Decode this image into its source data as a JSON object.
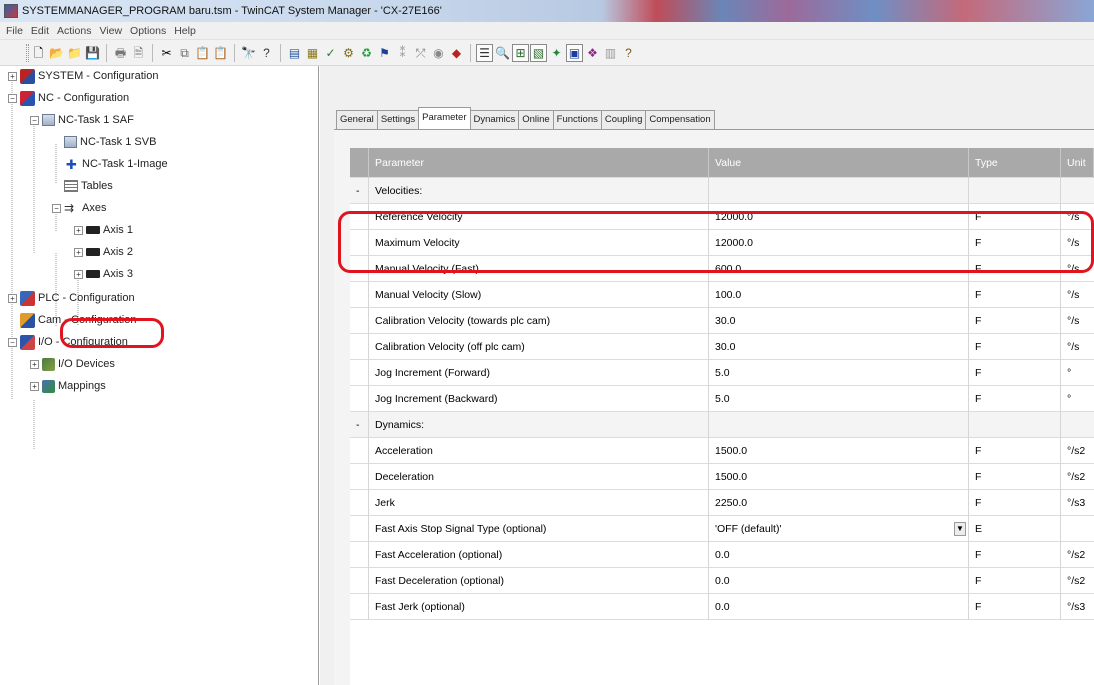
{
  "window": {
    "title": "SYSTEMMANAGER_PROGRAM baru.tsm - TwinCAT System Manager - 'CX-27E166'"
  },
  "menu": [
    "File",
    "Edit",
    "Actions",
    "View",
    "Options",
    "Help"
  ],
  "toolbar": {
    "icons": [
      "new-icon",
      "open-icon",
      "open-remote-icon",
      "save-icon",
      "print-icon",
      "print-preview-icon",
      "cut-icon",
      "copy-icon",
      "paste-icon",
      "paste-with-links-icon",
      "find-icon",
      "help-icon",
      "generate-mappings-icon",
      "check-configuration-icon",
      "activate-configuration-icon",
      "set-run-mode-icon",
      "restart-config-icon",
      "reload-devices-icon",
      "scan-devices-icon",
      "toggle-freerun-icon",
      "show-online-data-icon",
      "show-sub-items-icon",
      "zoom-icon",
      "view-icon",
      "graph-icon",
      "record-icon",
      "watch-icon",
      "settings-icon",
      "info-icon"
    ]
  },
  "tree": {
    "items": [
      {
        "label": "SYSTEM - Configuration"
      },
      {
        "label": "NC - Configuration"
      },
      {
        "label": "NC-Task 1 SAF"
      },
      {
        "label": "NC-Task 1 SVB"
      },
      {
        "label": "NC-Task 1-Image"
      },
      {
        "label": "Tables"
      },
      {
        "label": "Axes"
      },
      {
        "label": "Axis 1"
      },
      {
        "label": "Axis 2"
      },
      {
        "label": "Axis 3"
      },
      {
        "label": "PLC - Configuration"
      },
      {
        "label": "Cam - Configuration"
      },
      {
        "label": "I/O - Configuration"
      },
      {
        "label": "I/O Devices"
      },
      {
        "label": "Mappings"
      }
    ]
  },
  "tabs": [
    "General",
    "Settings",
    "Parameter",
    "Dynamics",
    "Online",
    "Functions",
    "Coupling",
    "Compensation"
  ],
  "active_tab": "Parameter",
  "grid": {
    "headers": {
      "parameter": "Parameter",
      "value": "Value",
      "type": "Type",
      "unit": "Unit"
    },
    "rows": [
      {
        "expander": "-",
        "parameter": "Velocities:",
        "value": "",
        "type": "",
        "unit": "",
        "group": true
      },
      {
        "expander": "",
        "parameter": "Reference Velocity",
        "value": "12000.0",
        "type": "F",
        "unit": "°/s"
      },
      {
        "expander": "",
        "parameter": "Maximum Velocity",
        "value": "12000.0",
        "type": "F",
        "unit": "°/s"
      },
      {
        "expander": "",
        "parameter": "Manual Velocity (Fast)",
        "value": "600.0",
        "type": "F",
        "unit": "°/s"
      },
      {
        "expander": "",
        "parameter": "Manual Velocity (Slow)",
        "value": "100.0",
        "type": "F",
        "unit": "°/s"
      },
      {
        "expander": "",
        "parameter": "Calibration Velocity (towards plc cam)",
        "value": "30.0",
        "type": "F",
        "unit": "°/s"
      },
      {
        "expander": "",
        "parameter": "Calibration Velocity (off plc cam)",
        "value": "30.0",
        "type": "F",
        "unit": "°/s"
      },
      {
        "expander": "",
        "parameter": "Jog Increment (Forward)",
        "value": "5.0",
        "type": "F",
        "unit": "°"
      },
      {
        "expander": "",
        "parameter": "Jog Increment (Backward)",
        "value": "5.0",
        "type": "F",
        "unit": "°"
      },
      {
        "expander": "-",
        "parameter": "Dynamics:",
        "value": "",
        "type": "",
        "unit": "",
        "group": true
      },
      {
        "expander": "",
        "parameter": "Acceleration",
        "value": "1500.0",
        "type": "F",
        "unit": "°/s2"
      },
      {
        "expander": "",
        "parameter": "Deceleration",
        "value": "1500.0",
        "type": "F",
        "unit": "°/s2"
      },
      {
        "expander": "",
        "parameter": "Jerk",
        "value": "2250.0",
        "type": "F",
        "unit": "°/s3"
      },
      {
        "expander": "",
        "parameter": "Fast Axis Stop Signal Type (optional)",
        "value": "'OFF (default)'",
        "type": "E",
        "unit": "",
        "dropdown": true
      },
      {
        "expander": "",
        "parameter": "Fast Acceleration (optional)",
        "value": "0.0",
        "type": "F",
        "unit": "°/s2"
      },
      {
        "expander": "",
        "parameter": "Fast Deceleration (optional)",
        "value": "0.0",
        "type": "F",
        "unit": "°/s2"
      },
      {
        "expander": "",
        "parameter": "Fast Jerk (optional)",
        "value": "0.0",
        "type": "F",
        "unit": "°/s3"
      }
    ]
  },
  "colors": {
    "highlight": "#e0141e",
    "header_bg": "#a9a9a9"
  }
}
